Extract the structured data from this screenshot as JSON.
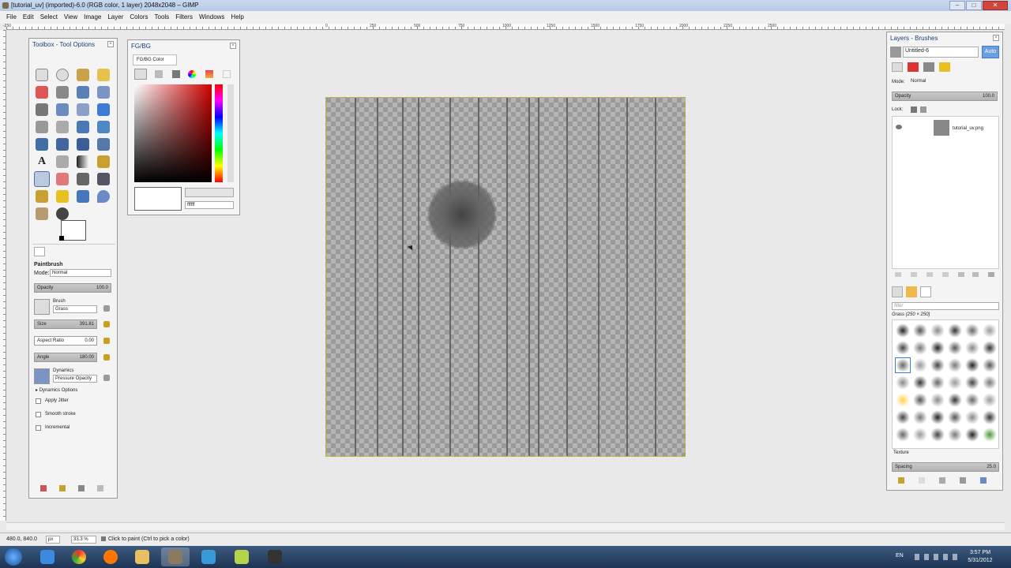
{
  "window": {
    "title": "[tutorial_uv] (imported)-6.0 (RGB color, 1 layer) 2048x2048 – GIMP",
    "buttons": [
      "–",
      "□",
      "✕"
    ]
  },
  "menu": [
    "File",
    "Edit",
    "Select",
    "View",
    "Image",
    "Layer",
    "Colors",
    "Tools",
    "Filters",
    "Windows",
    "Help"
  ],
  "ruler": {
    "ticks": [
      "-250",
      "0",
      "250",
      "500",
      "750",
      "1000",
      "1250",
      "1500",
      "1750",
      "2000",
      "2250",
      "2500"
    ]
  },
  "toolbox": {
    "title": "Toolbox - Tool Options",
    "tool_name": "Paintbrush",
    "mode_label": "Mode:",
    "mode_value": "Normal",
    "opacity_label": "Opacity",
    "opacity_value": "100.0",
    "brush_label": "Brush",
    "brush_value": "Grass",
    "size_label": "Size",
    "size_value": "391.81",
    "aspect_label": "Aspect Ratio",
    "aspect_value": "0.00",
    "angle_label": "Angle",
    "angle_value": "180.00",
    "dynamics_label": "Dynamics",
    "dynamics_value": "Pressure Opacity",
    "dynamics_options": "Dynamics Options",
    "apply_jitter": "Apply Jitter",
    "smooth_stroke": "Smooth stroke",
    "incremental": "Incremental"
  },
  "fgbg": {
    "title": "FG/BG",
    "tab": "FG/BG Color",
    "hex_value": "ffffff"
  },
  "layers": {
    "title": "Layers - Brushes",
    "image_name": "Untitled-6",
    "auto_label": "Auto",
    "mode_label": "Mode:",
    "mode_value": "Normal",
    "opacity_label": "Opacity",
    "opacity_value": "100.0",
    "lock_label": "Lock:",
    "layer_name": "tutorial_uv.png"
  },
  "brushes": {
    "filter_placeholder": "filter",
    "selected": "Grass (250 × 250)",
    "tag_label": "Texture",
    "spacing_label": "Spacing",
    "spacing_value": "25.0"
  },
  "status": {
    "coords": "480.0, 840.0",
    "unit": "px",
    "zoom": "33.3 %",
    "message": "Click to paint (Ctrl to pick a color)"
  },
  "taskbar": {
    "lang": "EN",
    "time": "3:57 PM",
    "date": "5/31/2012"
  },
  "colors": {
    "accent": "#3d7bd4",
    "title_text": "#1a3e7a",
    "taskbar": "#1d3454"
  }
}
